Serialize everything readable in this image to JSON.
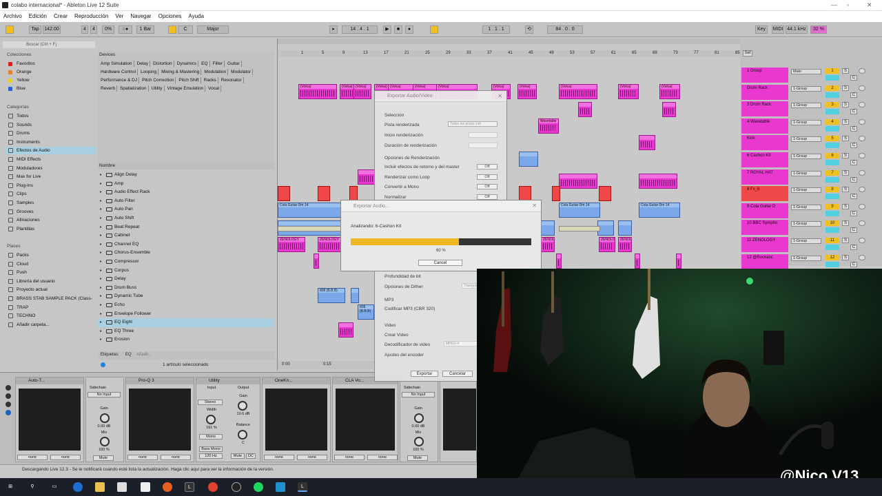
{
  "window": {
    "title": "colabo internacional* - Ableton Live 12 Suite"
  },
  "menu": [
    "Archivo",
    "Edición",
    "Crear",
    "Reproducción",
    "Ver",
    "Navegar",
    "Opciones",
    "Ayuda"
  ],
  "transport": {
    "tap": "Tap",
    "tempo": "142.00",
    "sig_num": "4",
    "sig_den": "4",
    "groove": "0%",
    "quantize": "1 Bar",
    "key": "C",
    "scale": "Major",
    "position": "14 . 4 . 1",
    "loop_start": "1 . 1 . 1",
    "loop_len": "84 . 0 . 0",
    "key_btn": "Key",
    "midi_btn": "MIDI",
    "sample_rate": "44.1 kHz",
    "cpu": "32 %"
  },
  "browser": {
    "search_placeholder": "Buscar (Ctrl + F)",
    "collections_title": "Colecciones",
    "collections": [
      {
        "label": "Favoritos",
        "color": "#e02020"
      },
      {
        "label": "Orange",
        "color": "#f08020"
      },
      {
        "label": "Yellow",
        "color": "#e8d020"
      },
      {
        "label": "Blue",
        "color": "#2060e0"
      }
    ],
    "categories_title": "Categorías",
    "categories": [
      "Todos",
      "Sounds",
      "Drums",
      "Instruments",
      "Efectos de Audio",
      "MIDI Effects",
      "Moduladores",
      "Max for Live",
      "Plug-Ins",
      "Clips",
      "Samples",
      "Grooves",
      "Afinaciones",
      "Plantillas"
    ],
    "places_title": "Places",
    "places": [
      "Packs",
      "Cloud",
      "Push",
      "Librería del usuario",
      "Proyecto actual",
      "BRASS STAB SAMPLE PACK (Class-",
      "TRAP",
      "TECHNO",
      "Añadir carpeta..."
    ],
    "devices_label": "Devices",
    "device_tags": [
      "Amp Simulation",
      "Delay",
      "Distortion",
      "Dynamics",
      "EQ",
      "Filter",
      "Guitar",
      "Hardware Control",
      "Looping",
      "Mixing & Mastering",
      "Modulation",
      "Modulator",
      "Performance & DJ",
      "Pitch Correction",
      "Pitch Shift",
      "Racks",
      "Resonator",
      "Reverb",
      "Spatialization",
      "Utility",
      "Vintage Emulation",
      "Vocal"
    ],
    "name_header": "Nombre",
    "fx_list": [
      "Align Delay",
      "Amp",
      "Audio Effect Rack",
      "Auto Filter",
      "Auto Pan",
      "Auto Shift",
      "Beat Repeat",
      "Cabinet",
      "Channel EQ",
      "Chorus-Ensemble",
      "Compressor",
      "Corpus",
      "Delay",
      "Drum Buss",
      "Dynamic Tube",
      "Echo",
      "Envelope Follower",
      "EQ Eight",
      "EQ Three",
      "Erosion"
    ],
    "selected_fx": "EQ Eight",
    "tags_label": "Etiquetas:",
    "tags_value": "EQ",
    "tags_add": "Añadir...",
    "selection_status": "1 artículo seleccionado"
  },
  "ruler": [
    "1",
    "5",
    "9",
    "13",
    "17",
    "21",
    "25",
    "29",
    "33",
    "37",
    "41",
    "45",
    "49",
    "53",
    "57",
    "61",
    "65",
    "69",
    "73",
    "77",
    "81",
    "85",
    "89"
  ],
  "timeline": [
    "0:00",
    "0:15"
  ],
  "clip_labels": {
    "volca": "(Volca)",
    "wavetable": "Wavetable",
    "fx": "Fx_8",
    "cola_guitar": "Cola Guitar Dm 14",
    "zenology": "ZENOLOGY",
    "bb808": "808 (B.B.B)"
  },
  "mixer": {
    "set_label": "Set",
    "tracks": [
      {
        "name": "1 Group",
        "route": "Main",
        "num": "1",
        "color": "#e838d0"
      },
      {
        "name": "Drum Rack",
        "route": "1-Group",
        "num": "2",
        "color": "#e838d0"
      },
      {
        "name": "3 Drum Rack",
        "route": "1-Group",
        "num": "3",
        "color": "#e838d0"
      },
      {
        "name": "4 Wavetable",
        "route": "1-Group",
        "num": "4",
        "color": "#e838d0"
      },
      {
        "name": "Kick",
        "route": "1-Group",
        "num": "5",
        "color": "#e838d0"
      },
      {
        "name": "6 Cashon Kit",
        "route": "1-Group",
        "num": "6",
        "color": "#e838d0"
      },
      {
        "name": "7 ROYAL HAT",
        "route": "1-Group",
        "num": "7",
        "color": "#e838d0"
      },
      {
        "name": "8 Fx_8",
        "route": "1-Group",
        "num": "8",
        "color": "#f04848"
      },
      {
        "name": "9 Cola Guitar D",
        "route": "1-Group",
        "num": "9",
        "color": "#e838d0"
      },
      {
        "name": "10 BBC Sympho",
        "route": "1-Group",
        "num": "10",
        "color": "#e838d0"
      },
      {
        "name": "11 ZENOLOGY",
        "route": "1-Group",
        "num": "11",
        "color": "#e838d0"
      },
      {
        "name": "12 @Rockanc",
        "route": "1-Group",
        "num": "12",
        "color": "#e838d0"
      }
    ]
  },
  "devices": [
    {
      "name": "Auto-T..."
    },
    {
      "name": "Pro-Q 3"
    },
    {
      "name": "Utility"
    },
    {
      "name": "OneKn..."
    },
    {
      "name": "CLA Vo..."
    }
  ],
  "device_labels": {
    "sidechain": "Sidechain",
    "no_input": "No Input",
    "gain": "Gain",
    "gain_val": "0.00 dB",
    "mix": "Mix",
    "mix_val": "100 %",
    "input": "Input",
    "output": "Output",
    "stereo": "Stereo",
    "width": "Width",
    "width_val": "161 %",
    "mono": "Mono",
    "bass_mono": "Bass Mono",
    "bass_freq": "120 Hz",
    "utility_gain": "10.6 dB",
    "balance": "Balance",
    "balance_val": "C",
    "mute": "Mute",
    "dc": "DC",
    "none": "none"
  },
  "status": "Descargando Live 12.3 - Se le notificará cuando esté lista la actualización. Haga clic aquí para ver la información de la versión.",
  "export_dialog": {
    "title": "Exportar Audio/Video",
    "selection": "Selección",
    "rendered_track": "Pista renderizada",
    "rendered_track_val": "Todas las pistas indi",
    "render_start": "Inicio renderización",
    "render_length": "Duración de renderización",
    "render_options": "Opciones de Renderización",
    "include_returns": "Incluir efectos de retorno y del master",
    "include_returns_val": "Off",
    "render_loop": "Renderizar como Loop",
    "render_loop_val": "Off",
    "convert_mono": "Convertir a Mono",
    "convert_mono_val": "Off",
    "normalize": "Normalizar",
    "normalize_val": "Off",
    "bit_depth": "Profundidad de bit",
    "dither": "Opciones de Dither",
    "dither_val": "Triangular",
    "mp3": "MP3",
    "encode_mp3": "Codificar MP3 (CBR 320)",
    "video": "Video",
    "create_video": "Crear Video",
    "video_encoder": "Decodificador de video",
    "video_encoder_val": "MPEG-4",
    "encoder_settings": "Ajustes del encoder",
    "export_btn": "Exportar",
    "cancel_btn": "Cancelar"
  },
  "progress_dialog": {
    "title": "Exportar Audio...",
    "status": "Analizando: 6-Cashon Kit",
    "percent_label": "60 %",
    "progress": 0.6,
    "cancel": "Cancel"
  },
  "webcam": {
    "watermark": "@Nico.V13"
  }
}
